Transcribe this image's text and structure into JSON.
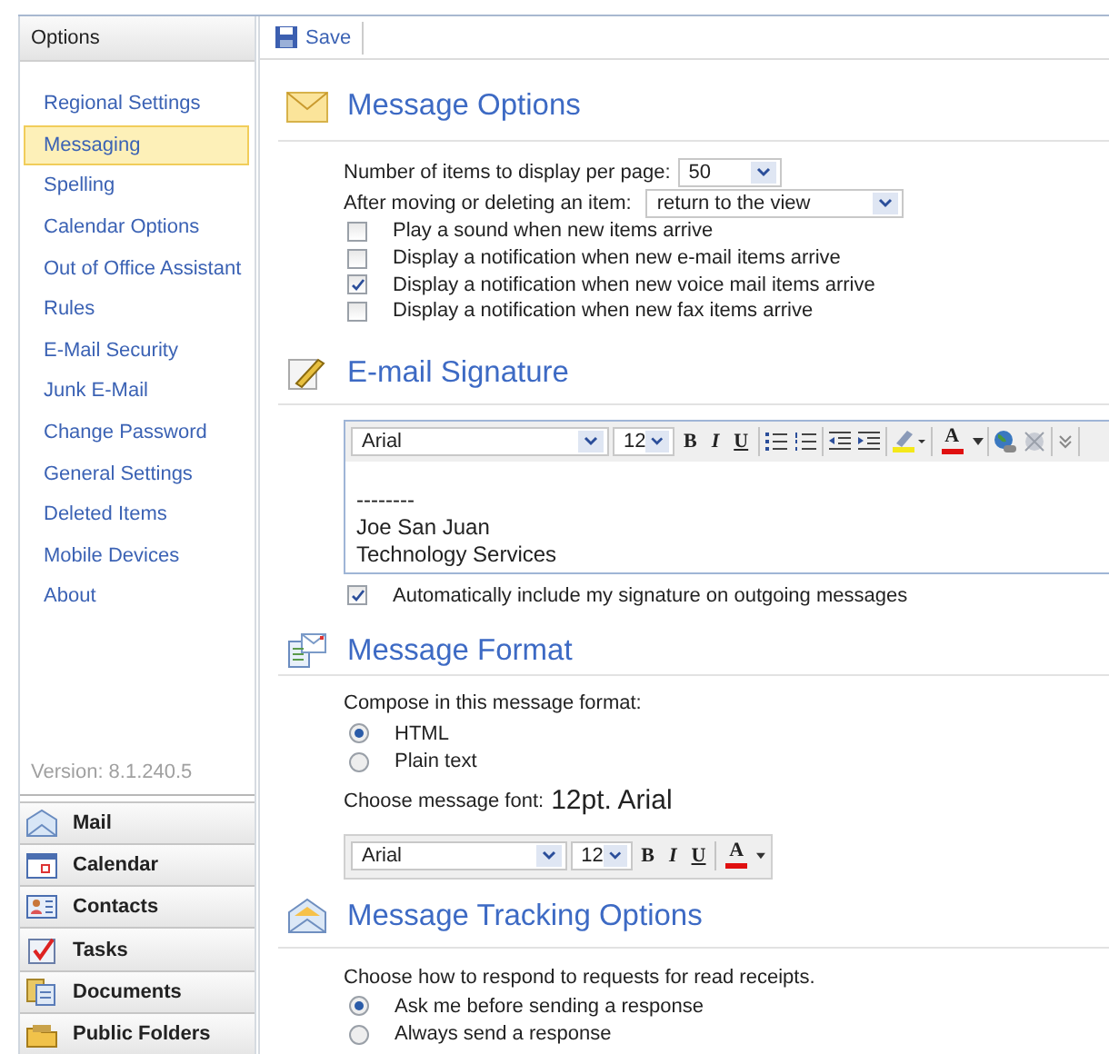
{
  "sidebar": {
    "title": "Options",
    "items": [
      {
        "label": "Regional Settings",
        "selected": false
      },
      {
        "label": "Messaging",
        "selected": true
      },
      {
        "label": "Spelling",
        "selected": false
      },
      {
        "label": "Calendar Options",
        "selected": false
      },
      {
        "label": "Out of Office Assistant",
        "selected": false
      },
      {
        "label": "Rules",
        "selected": false
      },
      {
        "label": "E-Mail Security",
        "selected": false
      },
      {
        "label": "Junk E-Mail",
        "selected": false
      },
      {
        "label": "Change Password",
        "selected": false
      },
      {
        "label": "General Settings",
        "selected": false
      },
      {
        "label": "Deleted Items",
        "selected": false
      },
      {
        "label": "Mobile Devices",
        "selected": false
      },
      {
        "label": "About",
        "selected": false
      }
    ],
    "version": "Version: 8.1.240.5",
    "nav": [
      {
        "label": "Mail",
        "kind": "mail"
      },
      {
        "label": "Calendar",
        "kind": "calendar"
      },
      {
        "label": "Contacts",
        "kind": "contacts"
      },
      {
        "label": "Tasks",
        "kind": "tasks"
      },
      {
        "label": "Documents",
        "kind": "documents"
      },
      {
        "label": "Public Folders",
        "kind": "folders"
      }
    ]
  },
  "toolbar": {
    "save": "Save"
  },
  "message_options": {
    "title": "Message Options",
    "items_per_page": {
      "label": "Number of items to display per page:",
      "value": "50"
    },
    "after_move": {
      "label": "After moving or deleting an item:",
      "value": "return to the view"
    },
    "checkboxes": [
      {
        "label": "Play a sound when new items arrive",
        "checked": false
      },
      {
        "label": "Display a notification when new e-mail items arrive",
        "checked": false
      },
      {
        "label": "Display a notification when new voice mail items arrive",
        "checked": true
      },
      {
        "label": "Display a notification when new fax items arrive",
        "checked": false
      }
    ]
  },
  "email_signature": {
    "title": "E-mail Signature",
    "editor": {
      "font": "Arial",
      "size": "12",
      "bold": "B",
      "italic": "I",
      "underline": "U",
      "font_color": "A",
      "kind": "full"
    },
    "lines": [
      "--------",
      "Joe San Juan",
      "Technology Services"
    ],
    "auto_include": {
      "label": "Automatically include my signature on outgoing messages",
      "checked": true
    }
  },
  "message_format": {
    "title": "Message Format",
    "compose_label": "Compose in this message format:",
    "formats": [
      {
        "label": "HTML",
        "selected": true
      },
      {
        "label": "Plain text",
        "selected": false
      }
    ],
    "font_label": "Choose message font:",
    "font_value": "12pt. Arial",
    "editor": {
      "font": "Arial",
      "size": "12",
      "bold": "B",
      "italic": "I",
      "underline": "U",
      "font_color": "A",
      "kind": "compact"
    }
  },
  "tracking": {
    "title": "Message Tracking Options",
    "prompt": "Choose how to respond to requests for read receipts.",
    "options": [
      {
        "label": "Ask me before sending a response",
        "selected": true
      },
      {
        "label": "Always send a response",
        "selected": false
      }
    ]
  }
}
